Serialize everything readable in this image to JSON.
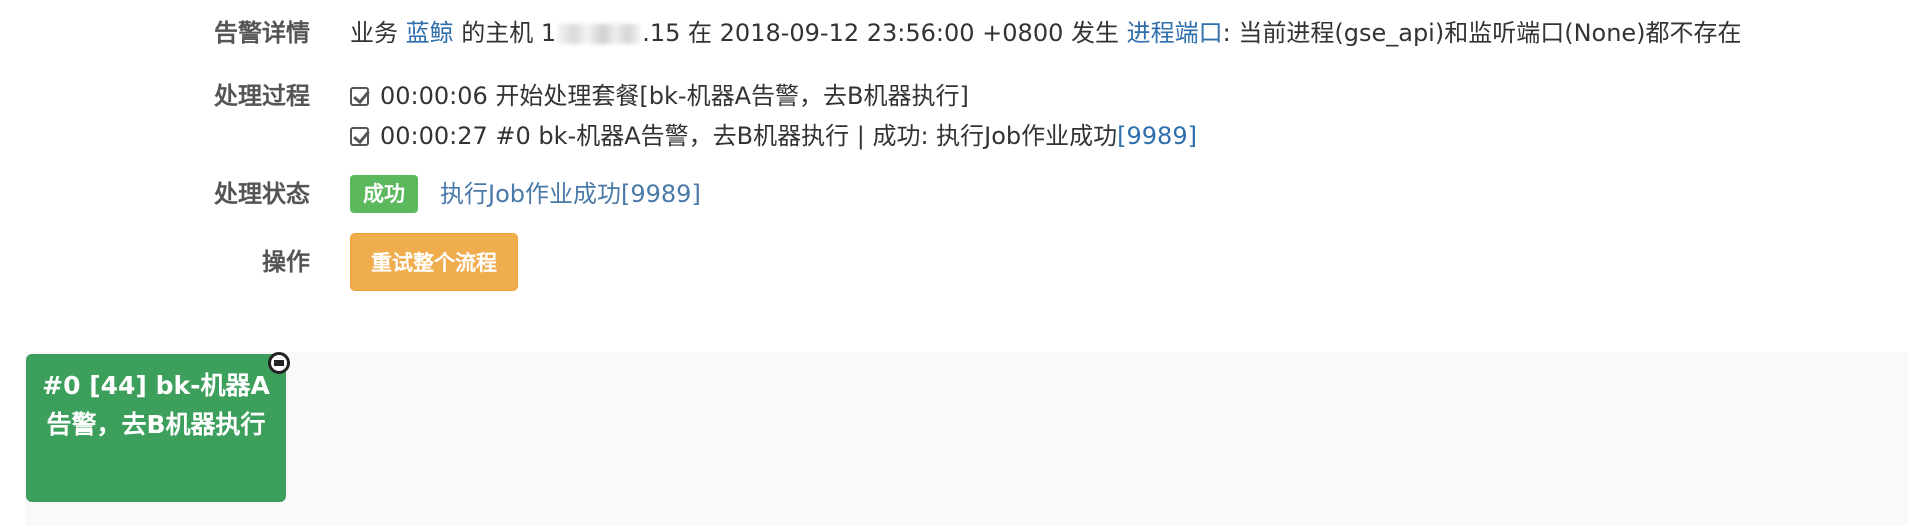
{
  "detail": {
    "label": "告警详情",
    "prefix": "业务",
    "business": "蓝鲸",
    "mid1": "的主机",
    "host_start": "1",
    "host_end": ".15",
    "mid2": "在",
    "time": "2018-09-12 23:56:00 +0800",
    "mid3": "发生",
    "alarm_type": "进程端口",
    "message": ": 当前进程(gse_api)和监听端口(None)都不存在"
  },
  "process": {
    "label": "处理过程",
    "steps": [
      {
        "text": "00:00:06 开始处理套餐[bk-机器A告警，去B机器执行]"
      },
      {
        "text": "00:00:27 #0 bk-机器A告警，去B机器执行 | 成功: 执行Job作业成功",
        "link": "[9989]"
      }
    ]
  },
  "status": {
    "label": "处理状态",
    "badge": "成功",
    "text": "执行Job作业成功",
    "link": "[9989]",
    "badge_color": "#5cb85c"
  },
  "operation": {
    "label": "操作",
    "retry_button": "重试整个流程",
    "button_color": "#f0ad4e"
  },
  "flow": {
    "node_label": "#0 [44] bk-机器A告警，去B机器执行",
    "node_color": "#3d9f5c",
    "node_icon": "refresh-icon"
  }
}
